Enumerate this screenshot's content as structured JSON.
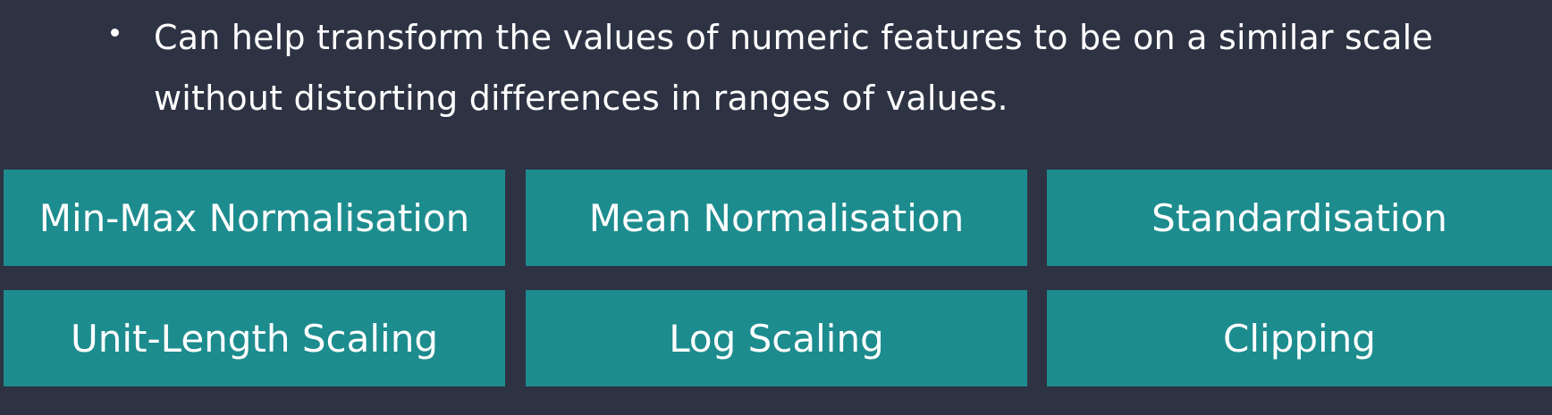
{
  "bullet": {
    "text": "Can help transform the values of numeric features to be on a similar scale without distorting differences in ranges of values."
  },
  "techniques": {
    "items": [
      {
        "label": "Min-Max Normalisation"
      },
      {
        "label": "Mean Normalisation"
      },
      {
        "label": "Standardisation"
      },
      {
        "label": "Unit-Length Scaling"
      },
      {
        "label": "Log Scaling"
      },
      {
        "label": "Clipping"
      }
    ]
  },
  "colors": {
    "background": "#2e3344",
    "tile": "#1d8c8e",
    "text": "#ffffff"
  }
}
